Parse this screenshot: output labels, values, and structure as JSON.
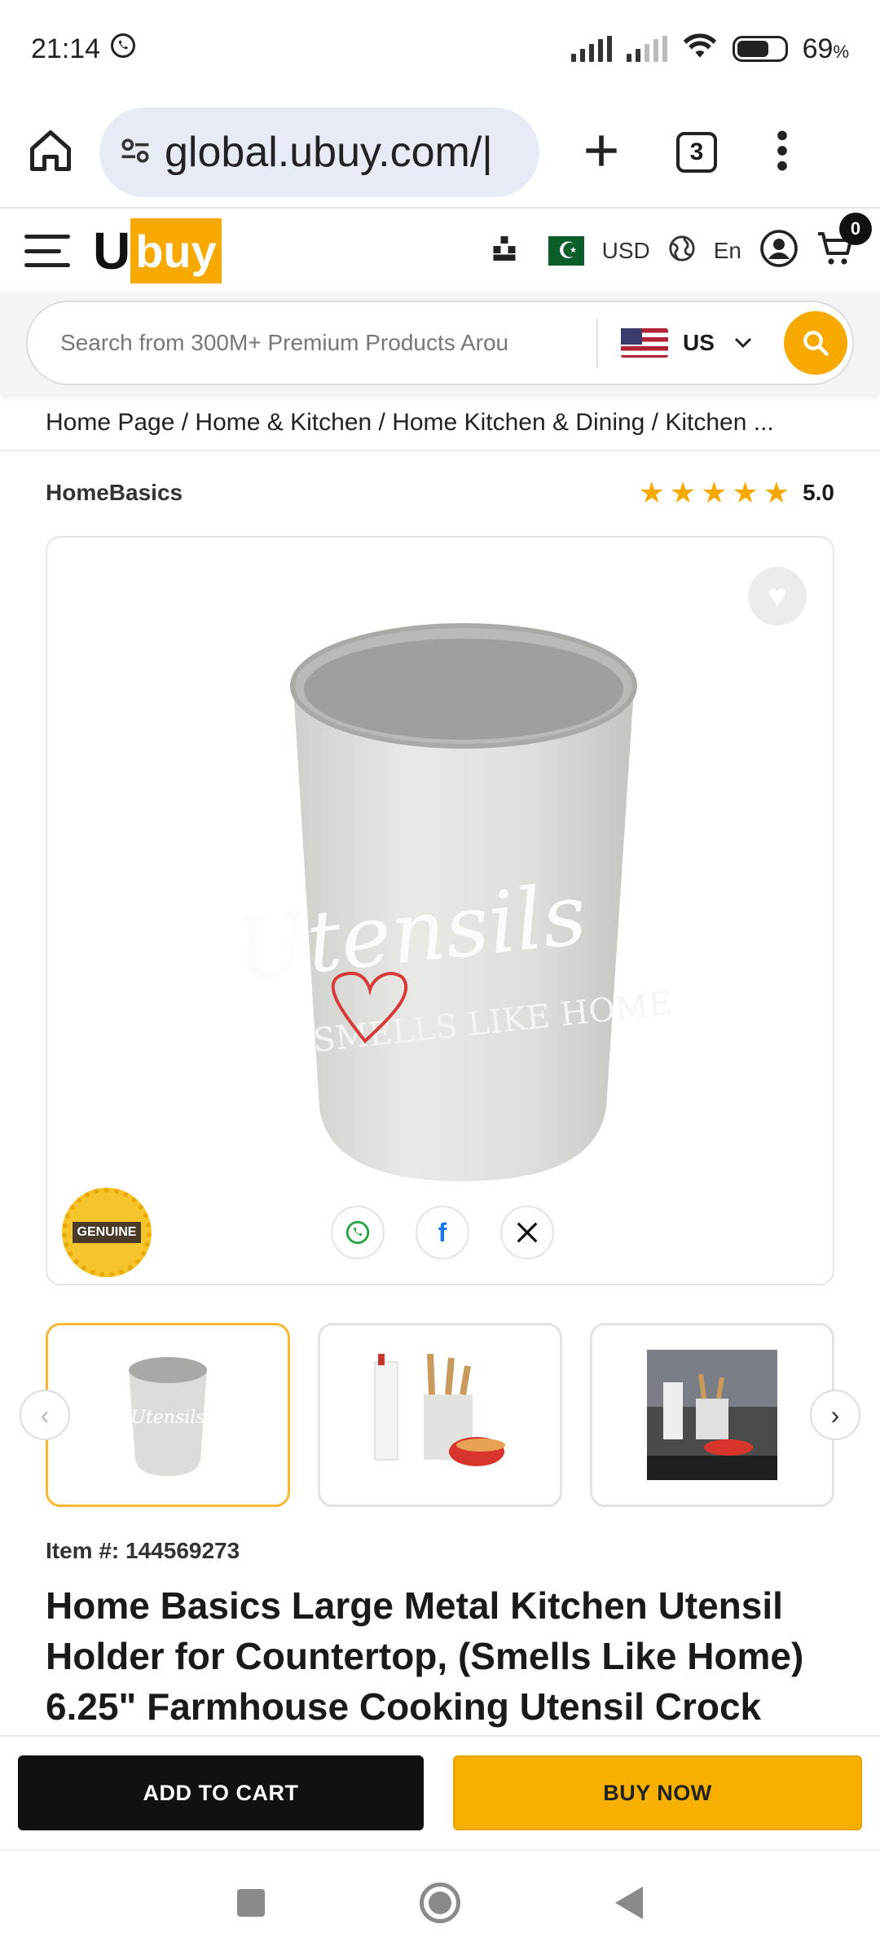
{
  "status": {
    "time": "21:14",
    "battery": "69",
    "battery_unit": "%"
  },
  "browser": {
    "url": "global.ubuy.com/|",
    "tab_count": "3"
  },
  "header": {
    "logo_u": "U",
    "logo_buy": "buy",
    "currency": "USD",
    "language": "En",
    "cart_count": "0"
  },
  "search": {
    "placeholder": "Search from 300M+ Premium Products Arou",
    "country": "US"
  },
  "breadcrumb": "Home Page / Home & Kitchen / Home Kitchen & Dining / Kitchen ...",
  "product": {
    "brand": "HomeBasics",
    "rating": "5.0",
    "stars": 5,
    "badge_text": "GENUINE",
    "mug_script": "Utensils",
    "mug_sub": "SMELLS LIKE HOME",
    "thumb_script": "Utensils",
    "item_number": "Item #: 144569273",
    "title": "Home Basics Large Metal Kitchen Utensil Holder for Countertop, (Smells Like Home) 6.25\" Farmhouse Cooking Utensil Crock"
  },
  "actions": {
    "add_to_cart": "ADD TO CART",
    "buy_now": "BUY NOW"
  },
  "colors": {
    "accent": "#f7a900",
    "dark": "#111111"
  }
}
